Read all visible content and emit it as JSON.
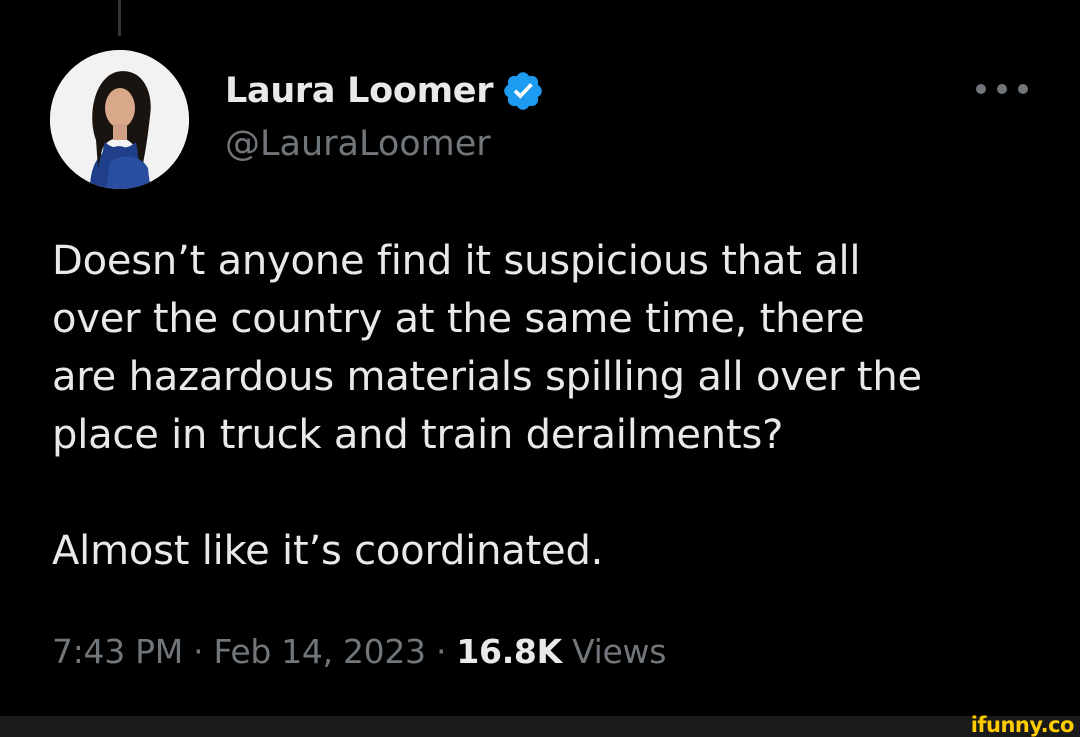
{
  "tweet": {
    "display_name": "Laura Loomer",
    "handle": "@LauraLoomer",
    "verified_icon": "verified-badge-icon",
    "more_icon": "more-options-icon",
    "text_lines_1": [
      "Doesn’t anyone find it suspicious that all",
      "over the country at the same time, there",
      "are hazardous materials spilling all over the",
      "place in truck and train derailments?"
    ],
    "text_line_2": "Almost like it’s coordinated.",
    "time": "7:43 PM",
    "separator": "·",
    "date": "Feb 14, 2023",
    "views_count": "16.8K",
    "views_label": "Views"
  },
  "watermark": "ifunny.co",
  "colors": {
    "background": "#000000",
    "primary_text": "#e7e9ea",
    "secondary_text": "#71767b",
    "verified_blue": "#1d9bf0",
    "watermark_yellow": "#ffcc00"
  }
}
